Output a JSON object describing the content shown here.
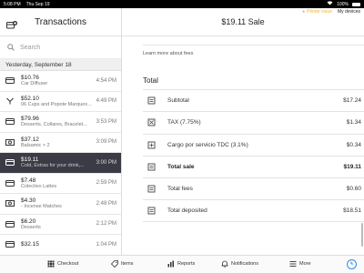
{
  "status_bar": {
    "time": "5:08 PM",
    "date": "Thu Sep 19",
    "battery": "100%",
    "printer_issue": "Printer issue",
    "my_devices": "My devices"
  },
  "left": {
    "title": "Transactions",
    "search_placeholder": "Search",
    "section_header": "Yesterday, September 18",
    "rows": [
      {
        "amount": "$10.76",
        "desc": "Car Diffuser",
        "time": "4:54 PM",
        "icon": "card-icon"
      },
      {
        "amount": "$52.10",
        "desc": "06 Cups and Popote Marquesa...",
        "time": "4:49 PM",
        "icon": "split-icon"
      },
      {
        "amount": "$79.96",
        "desc": "Desserts, Collares, Bracelet...",
        "time": "3:53 PM",
        "icon": "card-icon"
      },
      {
        "amount": "$37.12",
        "desc": "Balsamic × 2",
        "time": "3:09 PM",
        "icon": "cash-icon"
      },
      {
        "amount": "$19.11",
        "desc": "Cold, Extras for your drink,...",
        "time": "3:00 PM",
        "icon": "card-icon"
      },
      {
        "amount": "$7.48",
        "desc": "Colectivo Lattes",
        "time": "2:59 PM",
        "icon": "card-icon"
      },
      {
        "amount": "$4.30",
        "desc": "- Incense Matches",
        "time": "2:48 PM",
        "icon": "cash-icon"
      },
      {
        "amount": "$6.20",
        "desc": "Desserts",
        "time": "2:12 PM",
        "icon": "card-icon"
      },
      {
        "amount": "$32.15",
        "desc": "",
        "time": "1:04 PM",
        "icon": "card-icon"
      }
    ]
  },
  "right": {
    "title": "$19.11 Sale",
    "learn_more": "Learn more about fees",
    "section_title": "Total",
    "lines": [
      {
        "label": "Subtotal",
        "value": "$17.24",
        "icon": "receipt-icon",
        "bold": false
      },
      {
        "label": "TAX (7.75%)",
        "value": "$1.34",
        "icon": "tax-icon",
        "bold": false
      },
      {
        "label": "Cargo por servicio TDC (3.1%)",
        "value": "$0.34",
        "icon": "plus-icon",
        "bold": false
      },
      {
        "label": "Total sale",
        "value": "$19.11",
        "icon": "receipt-icon",
        "bold": true
      },
      {
        "label": "Total fees",
        "value": "$0.60",
        "icon": "receipt-icon",
        "bold": false
      },
      {
        "label": "Total deposited",
        "value": "$18.51",
        "icon": "receipt-icon",
        "bold": false
      }
    ]
  },
  "tabbar": {
    "checkout": "Checkout",
    "items": "Items",
    "reports": "Reports",
    "notifications": "Notifications",
    "more": "More"
  },
  "colors": {
    "selected_row": "#3b3b45",
    "printer_issue": "#f0b429",
    "accent": "#2d8cf0"
  }
}
